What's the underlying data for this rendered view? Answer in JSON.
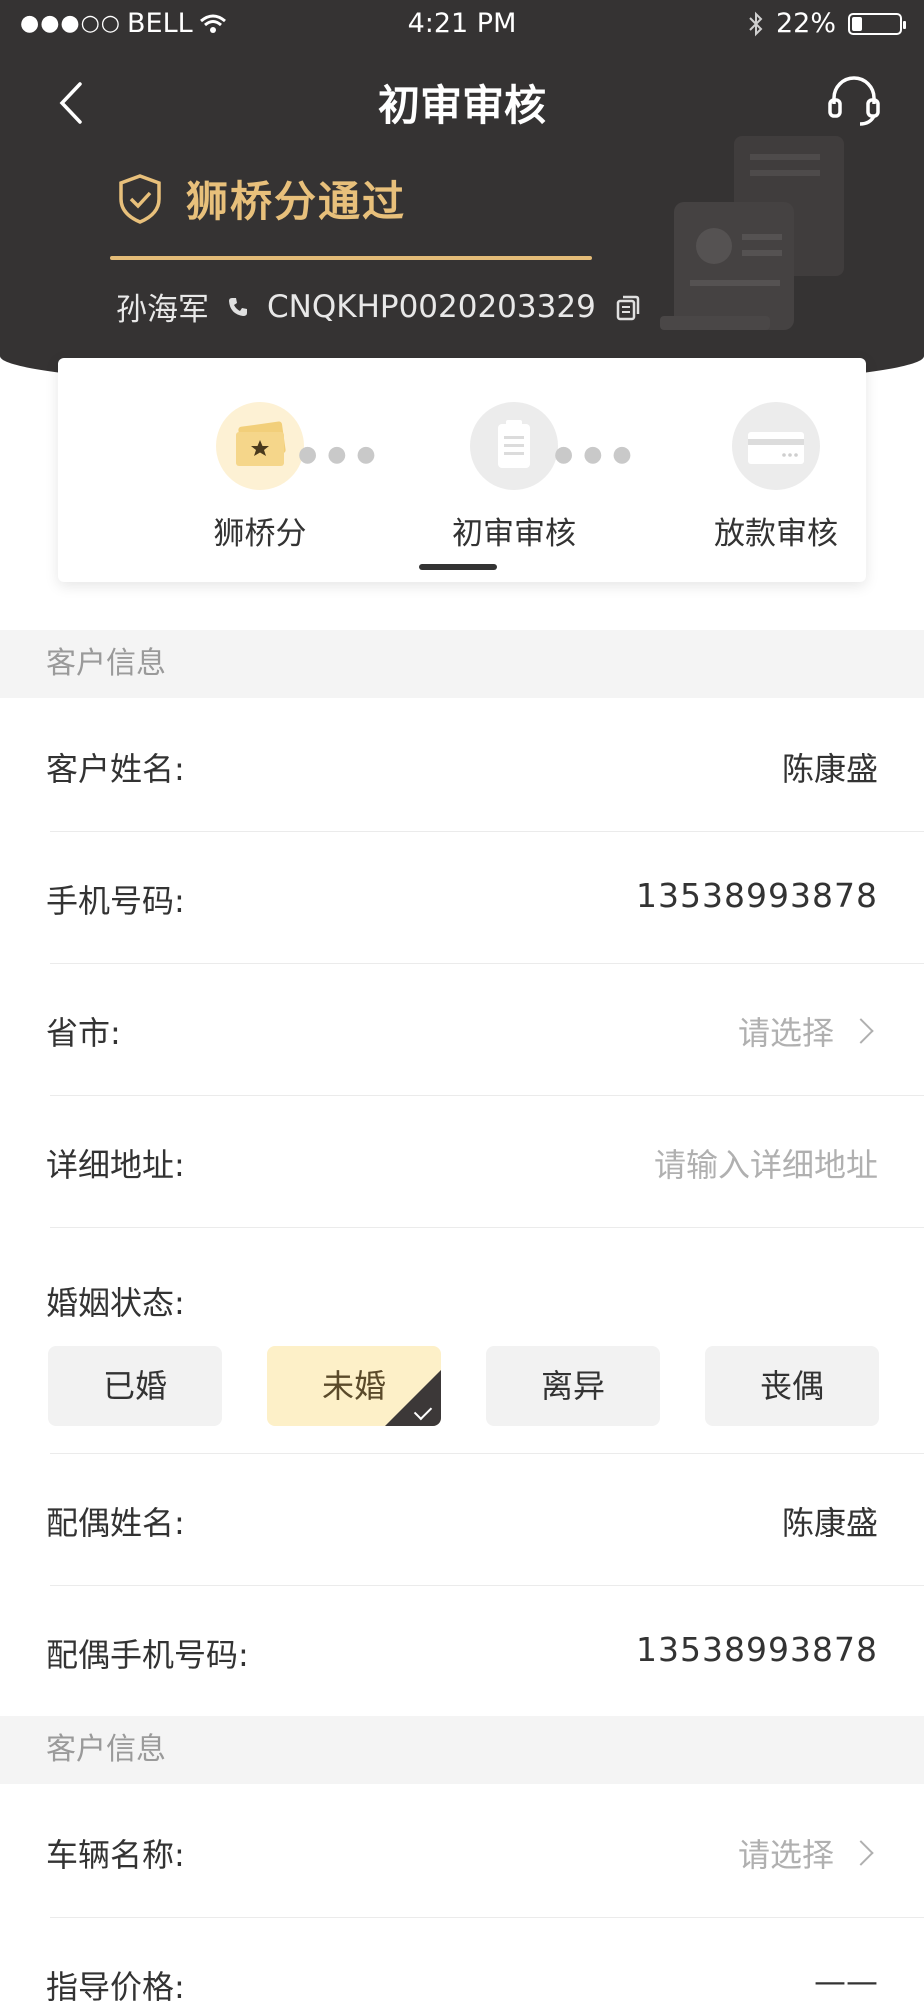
{
  "status_bar": {
    "signal": "●●●○○",
    "carrier": "BELL",
    "time": "4:21 PM",
    "battery_percent": "22%",
    "battery_level": 0.22
  },
  "nav": {
    "title": "初审审核",
    "back_icon": "chevron-left-icon",
    "support_icon": "headset-icon"
  },
  "badge": {
    "icon": "shield-check-icon",
    "text": "狮桥分通过"
  },
  "user": {
    "name": "孙海军",
    "phone_icon": "phone-icon",
    "code": "CNQKHP0020203329",
    "copy_icon": "copy-icon"
  },
  "steps": [
    {
      "label": "狮桥分",
      "icon": "star-card-icon"
    },
    {
      "label": "初审审核",
      "icon": "document-icon"
    },
    {
      "label": "放款审核",
      "icon": "credit-card-icon"
    }
  ],
  "active_step_index": 1,
  "section1": {
    "title": "客户信息",
    "customer_name": {
      "label": "客户姓名:",
      "value": "陈康盛"
    },
    "phone": {
      "label": "手机号码:",
      "value": "13538993878"
    },
    "province": {
      "label": "省市:",
      "placeholder": "请选择"
    },
    "address": {
      "label": "详细地址:",
      "placeholder": "请输入详细地址"
    },
    "marital": {
      "label": "婚姻状态:",
      "options": [
        "已婚",
        "未婚",
        "离异",
        "丧偶"
      ],
      "selected_index": 1
    },
    "spouse_name": {
      "label": "配偶姓名:",
      "value": "陈康盛"
    },
    "spouse_phone": {
      "label": "配偶手机号码:",
      "value": "13538993878"
    }
  },
  "section2": {
    "title": "客户信息",
    "vehicle": {
      "label": "车辆名称:",
      "placeholder": "请选择"
    },
    "price": {
      "label": "指导价格:",
      "value": "——"
    }
  },
  "colors": {
    "header_bg": "#353333",
    "gold": "#e8c07b",
    "selected_bg": "#fdf0c8"
  }
}
